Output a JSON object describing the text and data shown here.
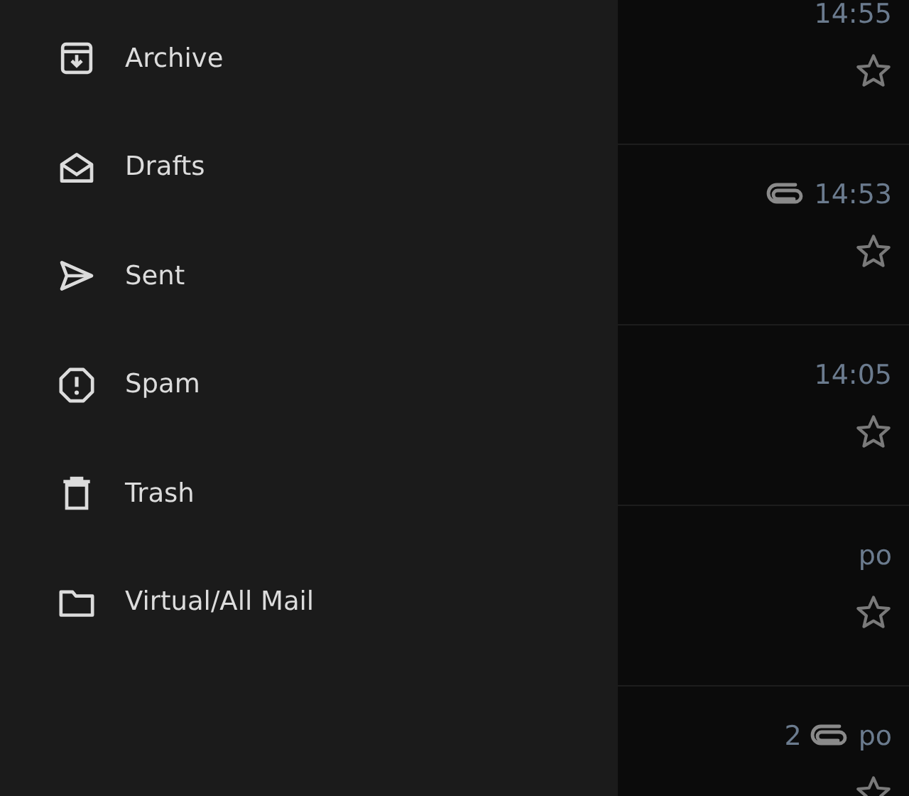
{
  "drawer": {
    "items": [
      {
        "kind": "archive",
        "label": "Archive"
      },
      {
        "kind": "drafts",
        "label": "Drafts"
      },
      {
        "kind": "sent",
        "label": "Sent"
      },
      {
        "kind": "spam",
        "label": "Spam"
      },
      {
        "kind": "trash",
        "label": "Trash"
      },
      {
        "kind": "folder",
        "label": "Virtual/All Mail"
      }
    ]
  },
  "messages": [
    {
      "time": "14:55",
      "attachment": false,
      "starred": false
    },
    {
      "time": "14:53",
      "attachment": true,
      "starred": false
    },
    {
      "time": "14:05",
      "attachment": false,
      "starred": false
    },
    {
      "time": "po",
      "attachment": false,
      "starred": false
    },
    {
      "time": "po",
      "count": "2",
      "attachment": true,
      "starred": false
    }
  ]
}
